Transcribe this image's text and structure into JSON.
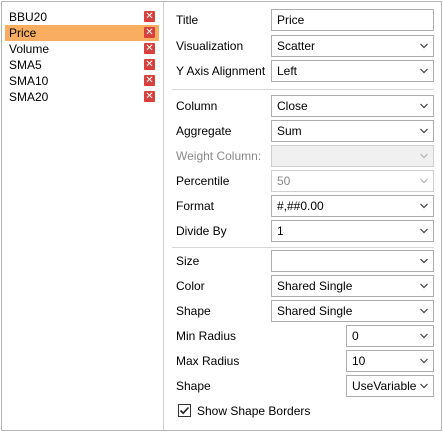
{
  "series_list": [
    {
      "label": "BBU20",
      "selected": false
    },
    {
      "label": "Price",
      "selected": true
    },
    {
      "label": "Volume",
      "selected": false
    },
    {
      "label": "SMA5",
      "selected": false
    },
    {
      "label": "SMA10",
      "selected": false
    },
    {
      "label": "SMA20",
      "selected": false
    }
  ],
  "delete_glyph": "✕",
  "properties": {
    "title": {
      "label": "Title",
      "value": "Price"
    },
    "visualization": {
      "label": "Visualization",
      "value": "Scatter"
    },
    "y_axis_alignment": {
      "label": "Y Axis Alignment",
      "value": "Left"
    },
    "column": {
      "label": "Column",
      "value": "Close"
    },
    "aggregate": {
      "label": "Aggregate",
      "value": "Sum"
    },
    "weight_column": {
      "label": "Weight Column:",
      "value": ""
    },
    "percentile": {
      "label": "Percentile",
      "value": "50"
    },
    "format": {
      "label": "Format",
      "value": "#,##0.00"
    },
    "divide_by": {
      "label": "Divide By",
      "value": "1"
    },
    "size": {
      "label": "Size",
      "value": ""
    },
    "color": {
      "label": "Color",
      "value": "Shared Single"
    },
    "shape": {
      "label": "Shape",
      "value": "Shared Single"
    },
    "min_radius": {
      "label": "Min Radius",
      "value": "0"
    },
    "max_radius": {
      "label": "Max Radius",
      "value": "10"
    },
    "shape2": {
      "label": "Shape",
      "value": "UseVariable"
    },
    "show_shape_borders": {
      "label": "Show Shape Borders",
      "checked": true
    }
  },
  "colors": {
    "selection": "#f8ad60",
    "delete_button": "#d9403b"
  }
}
